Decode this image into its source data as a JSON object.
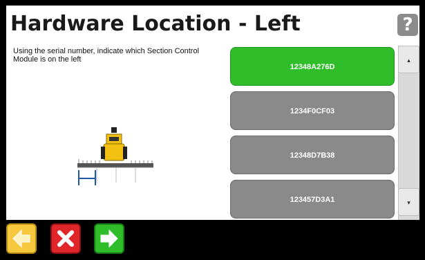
{
  "header": {
    "title": "Hardware Location - Left",
    "help_label": "?"
  },
  "instructions": "Using the serial number, indicate which Section Control Module is on the left",
  "modules": {
    "items": [
      {
        "label": "12348A276D",
        "selected": true
      },
      {
        "label": "1234F0CF03",
        "selected": false
      },
      {
        "label": "12348D7B38",
        "selected": false
      },
      {
        "label": "123457D3A1",
        "selected": false
      }
    ]
  },
  "scrollbar": {
    "up_icon": "chevron-up-icon",
    "down_icon": "chevron-down-icon",
    "up_glyph": "▴",
    "down_glyph": "▾"
  },
  "footer": {
    "buttons": [
      {
        "name": "back-button",
        "icon": "arrow-left-icon",
        "color": "#f6c83e"
      },
      {
        "name": "cancel-button",
        "icon": "close-icon",
        "color": "#e0262a"
      },
      {
        "name": "next-button",
        "icon": "arrow-right-icon",
        "color": "#2fbe2a"
      }
    ]
  },
  "colors": {
    "selected": "#2fbe2a",
    "unselected": "#8a8a8a",
    "vehicle": "#f2c012"
  }
}
